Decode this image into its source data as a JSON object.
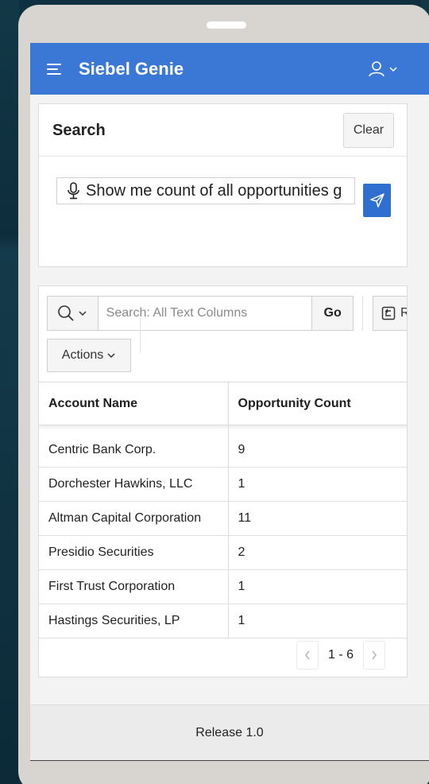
{
  "app": {
    "title": "Siebel Genie",
    "accent_color": "#3b78d6",
    "user_icon": "user-icon"
  },
  "search_region": {
    "title": "Search",
    "clear_label": "Clear",
    "prompt_value": "Show me count of all opportunities g",
    "mic_icon": "microphone-icon",
    "send_icon": "send-icon"
  },
  "report": {
    "search_placeholder": "Search: All Text Columns",
    "go_label": "Go",
    "reset_label": "Re",
    "actions_label": "Actions",
    "columns": [
      "Account Name",
      "Opportunity Count"
    ],
    "rows": [
      [
        "Centric Bank Corp.",
        "9"
      ],
      [
        "Dorchester Hawkins, LLC",
        "1"
      ],
      [
        "Altman Capital Corporation",
        "11"
      ],
      [
        "Presidio Securities",
        "2"
      ],
      [
        "First Trust Corporation",
        "1"
      ],
      [
        "Hastings Securities, LP",
        "1"
      ]
    ],
    "pagination_range": "1 - 6"
  },
  "footer": {
    "release": "Release 1.0"
  }
}
